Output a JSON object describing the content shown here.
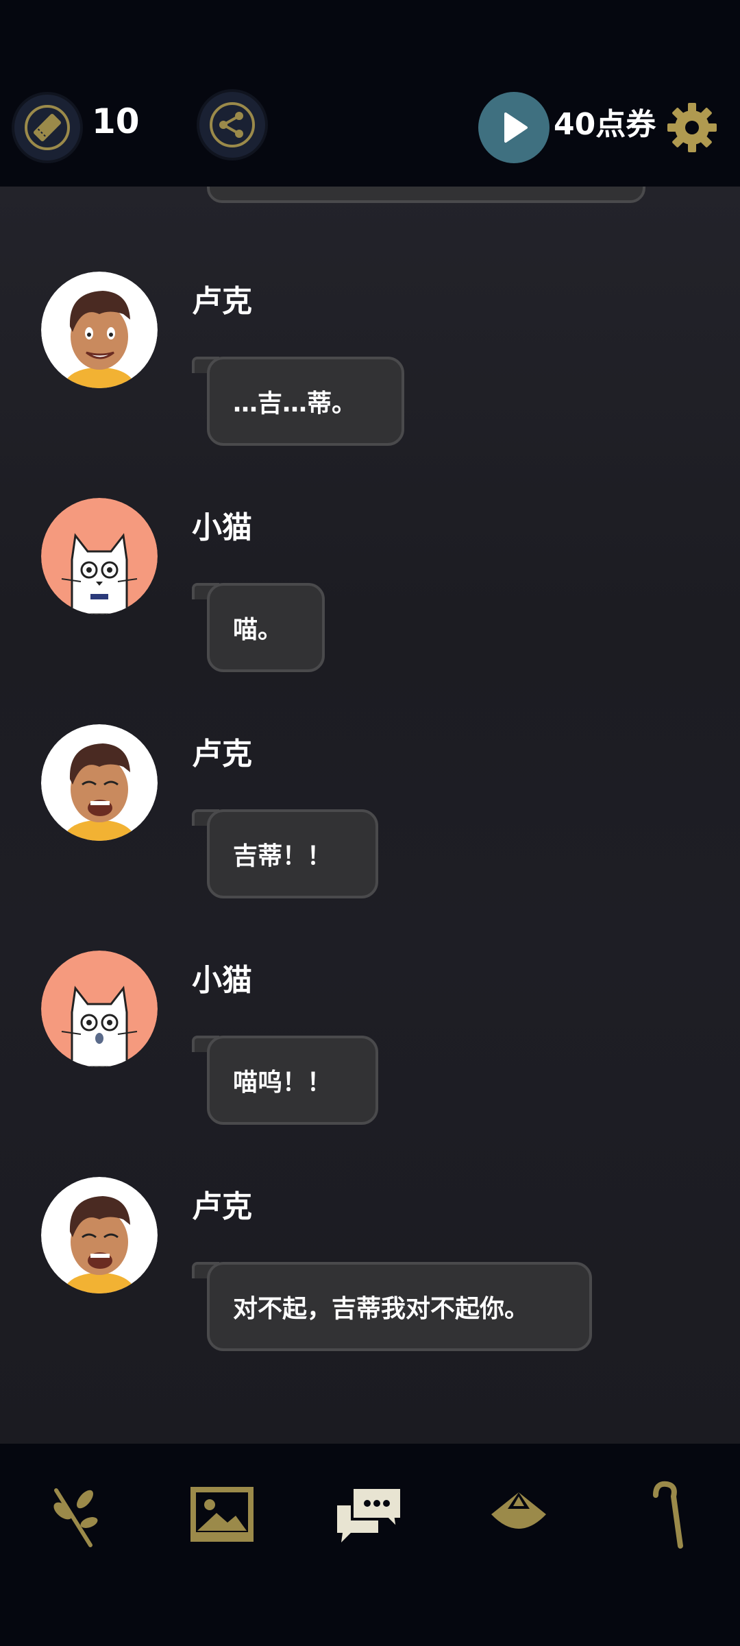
{
  "top_bar": {
    "ticket_count": "10",
    "points": "40点券",
    "icons": [
      "ticket-icon",
      "share-icon",
      "play-icon",
      "gear-icon"
    ]
  },
  "messages": [
    {
      "sender": "卢克",
      "text": "…吉…蒂。",
      "avatar": "luke"
    },
    {
      "sender": "小猫",
      "text": "喵。",
      "avatar": "cat"
    },
    {
      "sender": "卢克",
      "text": "吉蒂！！",
      "avatar": "luke"
    },
    {
      "sender": "小猫",
      "text": "喵呜！！",
      "avatar": "cat"
    },
    {
      "sender": "卢克",
      "text": "对不起，吉蒂我对不起你。",
      "avatar": "luke"
    }
  ],
  "bottom_nav": {
    "items": [
      "branch-icon",
      "image-gallery-icon",
      "chat-icon",
      "hat-icon",
      "cane-icon"
    ],
    "active": "chat-icon"
  },
  "colors": {
    "accent_gold": "#9b8a4a",
    "play_button": "#3f7080",
    "bubble_bg": "#323234",
    "cat_avatar_bg": "#f59a7e"
  }
}
